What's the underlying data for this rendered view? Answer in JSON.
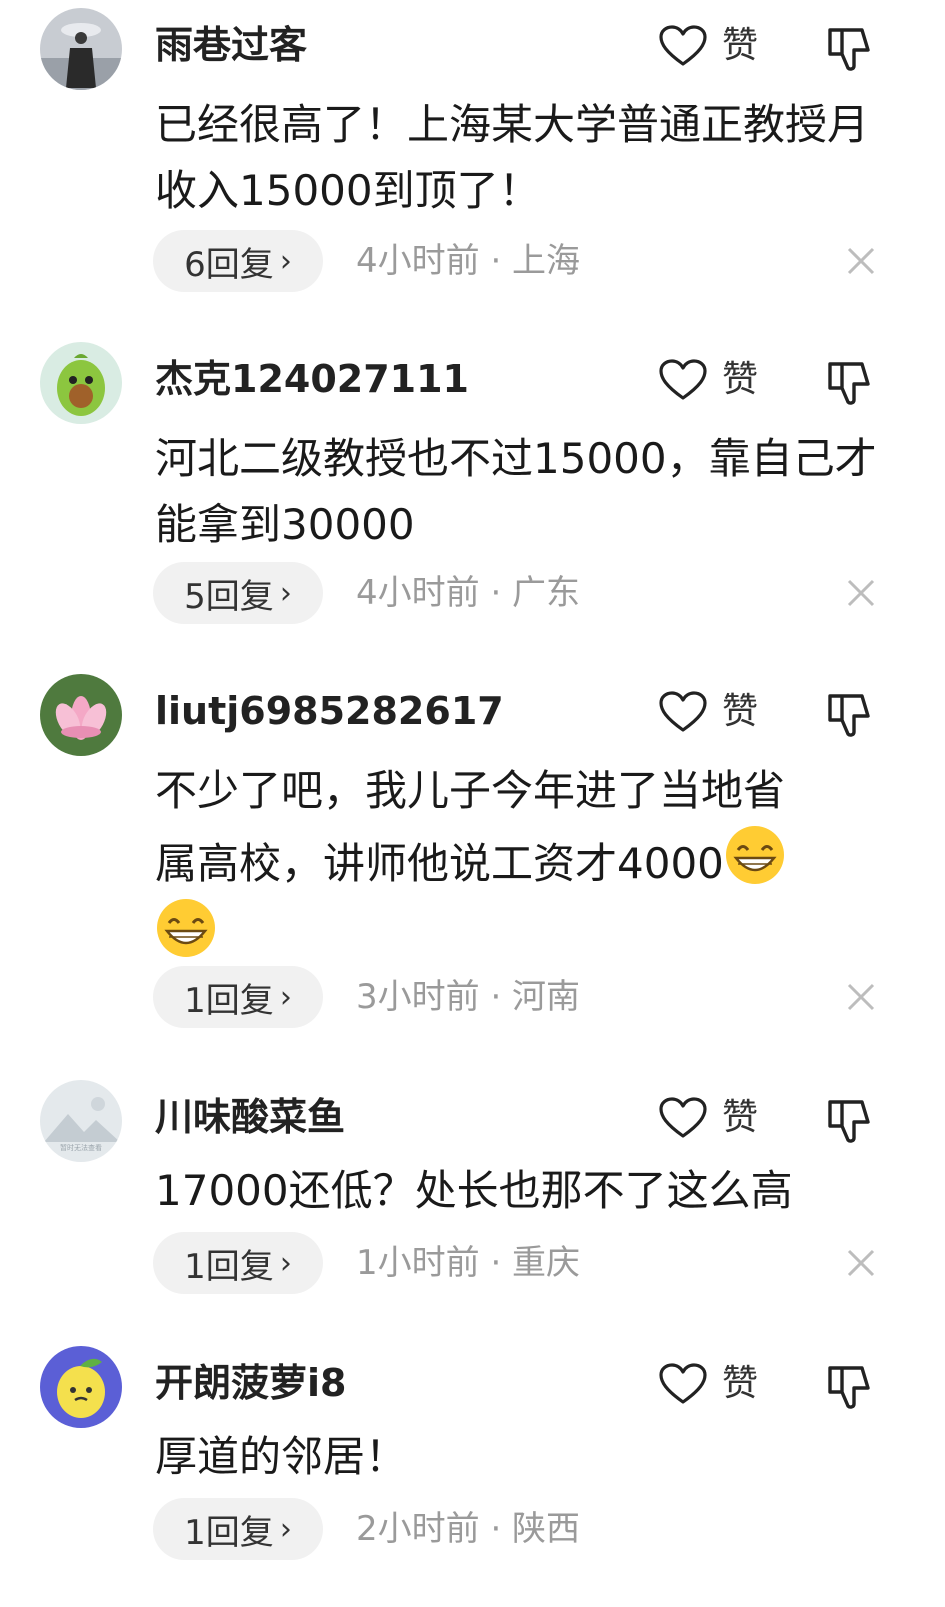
{
  "comments": [
    {
      "username": "雨巷过客",
      "text": "已经很高了！上海某大学普通正教授月收入15000到顶了！",
      "like_label": "赞",
      "replies": "6回复",
      "time_location": "4小时前 · 上海",
      "avatar_icon": "man-in-rain-avatar"
    },
    {
      "username": "杰克124027111",
      "text": "河北二级教授也不过15000，靠自己才能拿到30000",
      "like_label": "赞",
      "replies": "5回复",
      "time_location": "4小时前 · 广东",
      "avatar_icon": "avocado-avatar"
    },
    {
      "username": "liutj6985282617",
      "text_line1": "不少了吧，我儿子今年进了当地省",
      "text_line2": "属高校，讲师他说工资才4000",
      "emoji": "grinning-face-emoji",
      "like_label": "赞",
      "replies": "1回复",
      "time_location": "3小时前 · 河南",
      "avatar_icon": "lotus-avatar"
    },
    {
      "username": "川味酸菜鱼",
      "text": "17000还低？处长也那不了这么高",
      "like_label": "赞",
      "replies": "1回复",
      "time_location": "1小时前 · 重庆",
      "avatar_icon": "default-landscape-avatar",
      "avatar_caption": "暂时无法查看"
    },
    {
      "username": "开朗菠萝i8",
      "text": "厚道的邻居！",
      "like_label": "赞",
      "replies": "1回复",
      "time_location": "2小时前 · 陕西",
      "avatar_icon": "lemon-avatar"
    }
  ],
  "icons": {
    "like": "heart-outline-icon",
    "dislike": "thumbs-down-icon",
    "close": "close-icon",
    "chevron": "chevron-right-icon"
  },
  "colors": {
    "text": "#1a1a1a",
    "meta": "#9a9a9a",
    "pill": "#f1f1f1"
  }
}
